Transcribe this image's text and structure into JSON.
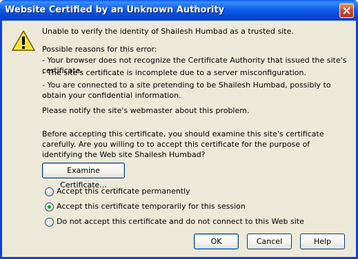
{
  "window": {
    "title": "Website Certified by an Unknown Authority"
  },
  "message": {
    "intro": "Unable to verify the identity of Shailesh Humbad as a trusted site.",
    "reasons_heading": "Possible reasons for this error:",
    "reasons": [
      "- Your browser does not recognize the Certificate Authority that issued the site's certificate.",
      "- The site's certificate is incomplete due to a server misconfiguration.",
      "- You are connected to a site pretending to be Shailesh Humbad, possibly to obtain your confidential information."
    ],
    "notify": "Please notify the site's webmaster about this problem.",
    "question": "Before accepting this certificate, you should examine this site's certificate carefully. Are you willing to to accept this certificate for the purpose of identifying the Web site Shailesh Humbad?"
  },
  "examine_button": "Examine Certificate...",
  "options": [
    {
      "label": "Accept this certificate permanently",
      "selected": false
    },
    {
      "label": "Accept this certificate temporarily for this session",
      "selected": true
    },
    {
      "label": "Do not accept this certificate and do not connect to this Web site",
      "selected": false
    }
  ],
  "buttons": {
    "ok": "OK",
    "cancel": "Cancel",
    "help": "Help"
  },
  "icons": {
    "warning": "warning-icon",
    "close": "close-icon"
  }
}
